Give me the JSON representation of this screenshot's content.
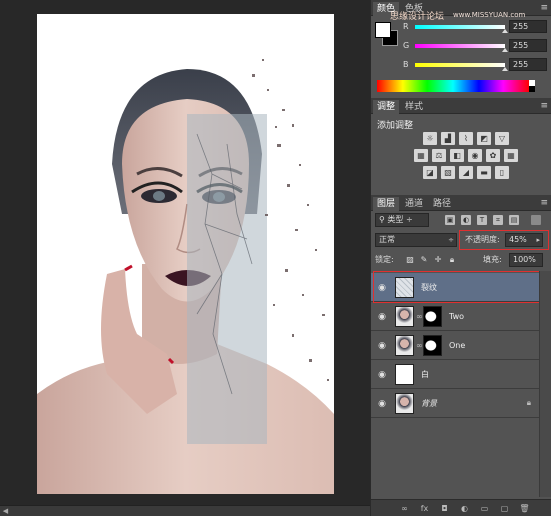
{
  "color_panel": {
    "tab_label": "颜色",
    "tab2_label": "色板",
    "channels": [
      {
        "label": "R",
        "value": "255",
        "level": 1.0,
        "gradient": "linear-gradient(90deg,#00ffff,#ffffff)"
      },
      {
        "label": "G",
        "value": "255",
        "level": 1.0,
        "gradient": "linear-gradient(90deg,#ff00ff,#ffffff)"
      },
      {
        "label": "B",
        "value": "255",
        "level": 1.0,
        "gradient": "linear-gradient(90deg,#ffff00,#ffffff)"
      }
    ]
  },
  "watermark": {
    "text": "思缘设计论坛",
    "url": "www.MISSYUAN.com"
  },
  "adjustments_panel": {
    "tabs": [
      "调整",
      "样式"
    ],
    "title": "添加调整",
    "icons": [
      [
        "brightness-icon",
        "levels-icon",
        "curves-icon",
        "exposure-icon",
        "vibrance-icon"
      ],
      [
        "hue-saturation-icon",
        "color-balance-icon",
        "black-white-icon",
        "photo-filter-icon",
        "channel-mixer-icon",
        "color-lookup-icon"
      ],
      [
        "invert-icon",
        "posterize-icon",
        "threshold-icon",
        "gradient-map-icon",
        "selective-color-icon"
      ]
    ]
  },
  "layers_panel": {
    "tabs": [
      "图层",
      "通道",
      "路径"
    ],
    "filter_kind": "类型",
    "blend_mode": "正常",
    "opacity_label": "不透明度:",
    "opacity_value": "45%",
    "lock_label": "锁定:",
    "fill_label": "填充:",
    "fill_value": "100%",
    "layers": [
      {
        "name": "裂纹",
        "selected": true,
        "visible": true,
        "has_mask": false,
        "italic": false,
        "locked": false,
        "thumb": "crack-texture"
      },
      {
        "name": "Two",
        "selected": false,
        "visible": true,
        "has_mask": true,
        "italic": false,
        "locked": false,
        "thumb": "portrait"
      },
      {
        "name": "One",
        "selected": false,
        "visible": true,
        "has_mask": true,
        "italic": false,
        "locked": false,
        "thumb": "portrait"
      },
      {
        "name": "白",
        "selected": false,
        "visible": true,
        "has_mask": false,
        "italic": false,
        "locked": false,
        "thumb": "white"
      },
      {
        "name": "背景",
        "selected": false,
        "visible": true,
        "has_mask": false,
        "italic": true,
        "locked": true,
        "thumb": "portrait"
      }
    ],
    "footer_icons": [
      "link-layers-icon",
      "fx-icon",
      "add-mask-icon",
      "new-adjustment-icon",
      "new-group-icon",
      "new-layer-icon",
      "delete-layer-icon"
    ]
  }
}
